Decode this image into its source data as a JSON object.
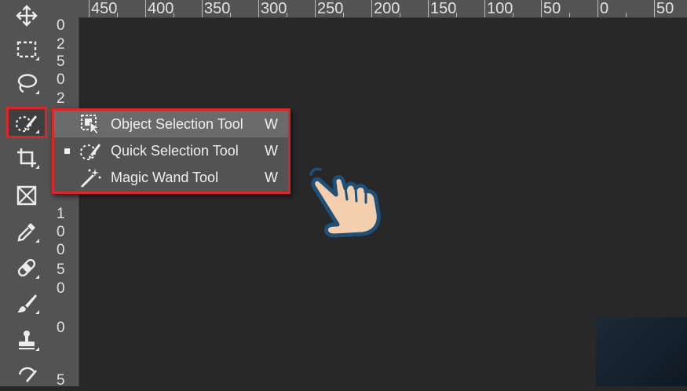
{
  "toolbar": {
    "tools": [
      {
        "name": "move-tool",
        "icon": "move-icon"
      },
      {
        "name": "rectangular-marquee-tool",
        "icon": "marquee-icon"
      },
      {
        "name": "lasso-tool",
        "icon": "lasso-icon"
      },
      {
        "name": "quick-selection-tool",
        "icon": "quick-selection-icon",
        "active": true
      },
      {
        "name": "crop-tool",
        "icon": "crop-icon"
      },
      {
        "name": "frame-tool",
        "icon": "frame-icon"
      },
      {
        "name": "eyedropper-tool",
        "icon": "eyedropper-icon"
      },
      {
        "name": "healing-brush-tool",
        "icon": "bandage-icon"
      },
      {
        "name": "brush-tool",
        "icon": "brush-icon"
      },
      {
        "name": "clone-stamp-tool",
        "icon": "stamp-icon"
      },
      {
        "name": "history-brush-tool",
        "icon": "history-brush-icon"
      }
    ]
  },
  "ruler_top": {
    "labels": [
      "450",
      "400",
      "350",
      "300",
      "250",
      "200",
      "150",
      "100",
      "50",
      "0",
      "50"
    ]
  },
  "ruler_left": {
    "labels": [
      "0",
      "2",
      "5",
      "0",
      "2",
      "1",
      "0",
      "0",
      "5",
      "0",
      "0",
      "5"
    ]
  },
  "flyout": {
    "items": [
      {
        "label": "Object Selection Tool",
        "shortcut": "W",
        "icon": "object-selection-icon",
        "selected": false
      },
      {
        "label": "Quick Selection Tool",
        "shortcut": "W",
        "icon": "quick-selection-icon",
        "selected": true
      },
      {
        "label": "Magic Wand Tool",
        "shortcut": "W",
        "icon": "magic-wand-icon",
        "selected": false
      }
    ]
  },
  "colors": {
    "highlight": "#d9262c",
    "panel": "#535353",
    "canvas": "#282828",
    "hand_fill": "#f4cfae",
    "hand_outline": "#1f5079"
  },
  "overlay": {
    "icon": "pointing-hand-icon"
  }
}
